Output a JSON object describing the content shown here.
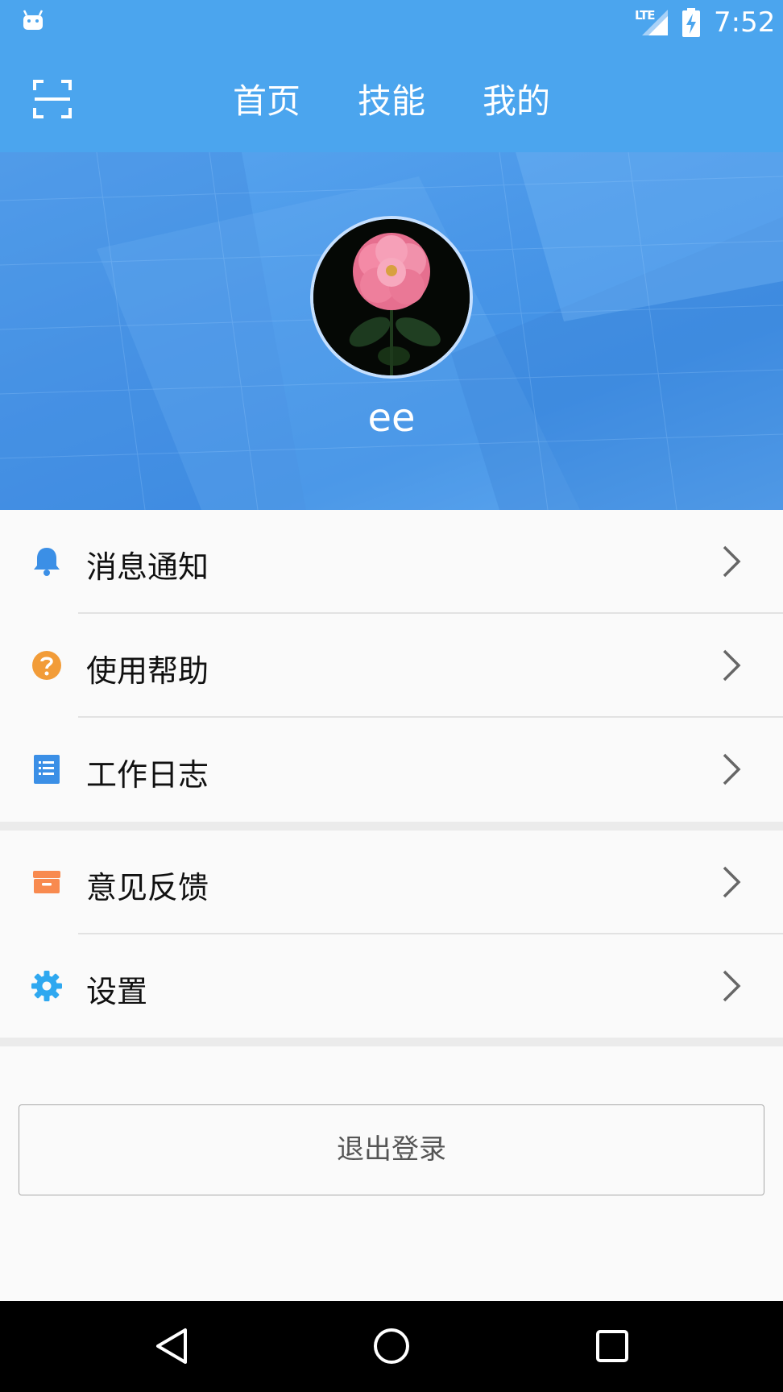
{
  "status_bar": {
    "network": "LTE",
    "time": "7:52"
  },
  "toolbar": {
    "tabs": [
      {
        "label": "首页"
      },
      {
        "label": "技能"
      },
      {
        "label": "我的"
      }
    ],
    "active_tab": "我的"
  },
  "profile": {
    "username": "ee",
    "avatar": "rose-photo"
  },
  "menu": {
    "items": [
      {
        "label": "消息通知",
        "icon": "bell-icon"
      },
      {
        "label": "使用帮助",
        "icon": "help-icon"
      },
      {
        "label": "工作日志",
        "icon": "notebook-icon"
      },
      {
        "label": "意见反馈",
        "icon": "feedback-box-icon"
      },
      {
        "label": "设置",
        "icon": "gear-icon"
      }
    ]
  },
  "logout": {
    "label": "退出登录"
  },
  "colors": {
    "primary": "#4ba5ee",
    "bell": "#3b8fe6",
    "help": "#f29c38",
    "notebook": "#3b8fe6",
    "feedback": "#f88a4f",
    "gear": "#2fa8f0"
  }
}
